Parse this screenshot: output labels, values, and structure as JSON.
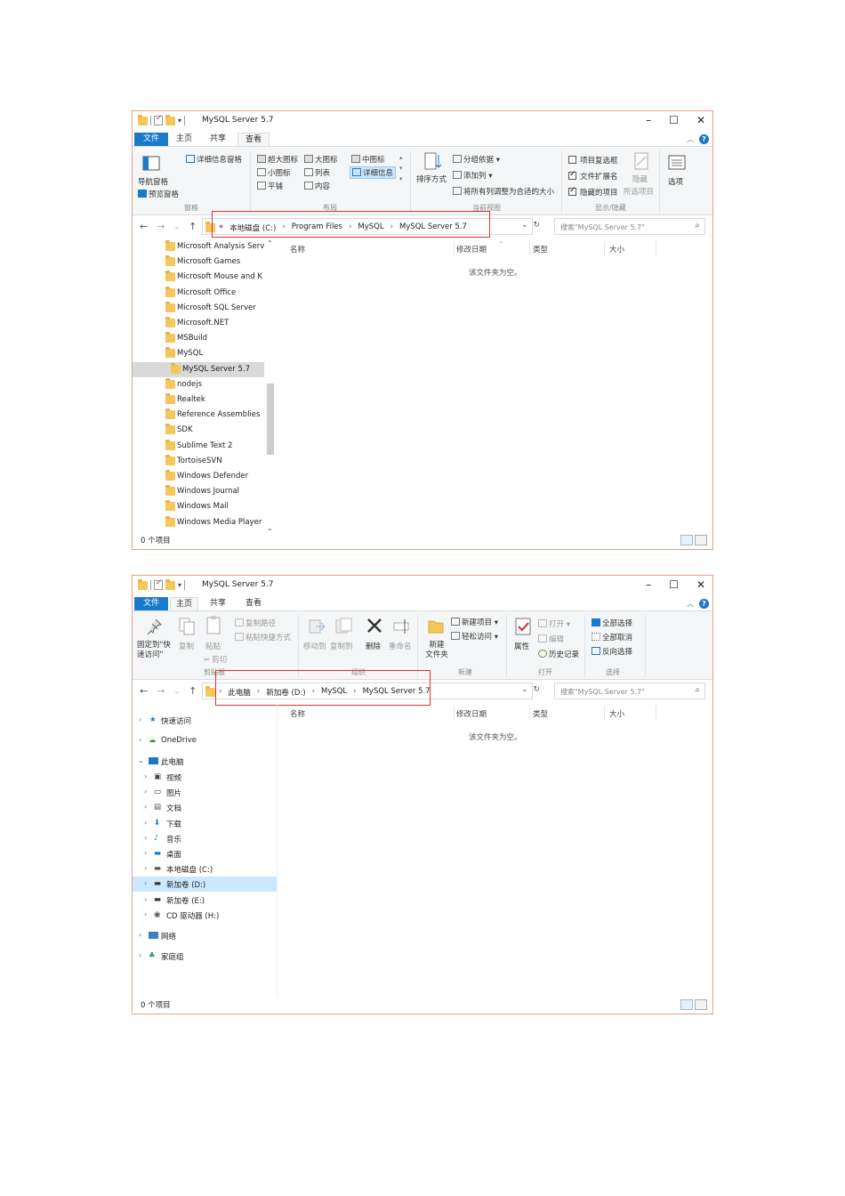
{
  "window1": {
    "title": "MySQL Server 5.7",
    "tabs": [
      "文件",
      "主页",
      "共享",
      "查看"
    ],
    "ribbon": {
      "panes_group": {
        "nav_pane": "导航窗格",
        "preview_pane": "预览窗格",
        "details_pane": "详细信息窗格",
        "label": "窗格"
      },
      "layout_group": {
        "items": [
          "超大图标",
          "大图标",
          "中图标",
          "小图标",
          "列表",
          "详细信息",
          "平铺",
          "内容"
        ],
        "label": "布局"
      },
      "view_group": {
        "sort": "排序方式",
        "group_by": "分组依据",
        "add_col": "添加列",
        "fit_cols": "将所有列调整为合适的大小",
        "label": "当前视图"
      },
      "show_group": {
        "item_checkboxes": "项目复选框",
        "file_ext": "文件扩展名",
        "hidden_items": "隐藏的项目",
        "hide": "隐藏",
        "hide_sel": "所选项目",
        "options": "选项",
        "label": "显示/隐藏"
      }
    },
    "path": [
      "«",
      "本地磁盘 (C:)",
      "Program Files",
      "MySQL",
      "MySQL Server 5.7"
    ],
    "search_placeholder": "搜索\"MySQL Server 5.7\"",
    "nav_items": [
      "Microsoft Analysis Servi",
      "Microsoft Games",
      "Microsoft Mouse and K",
      "Microsoft Office",
      "Microsoft SQL Server",
      "Microsoft.NET",
      "MSBuild",
      "MySQL",
      "MySQL Server 5.7",
      "nodejs",
      "Realtek",
      "Reference Assemblies",
      "SDK",
      "Sublime Text 2",
      "TortoiseSVN",
      "Windows Defender",
      "Windows Journal",
      "Windows Mail",
      "Windows Media Player"
    ],
    "columns": [
      "名称",
      "修改日期",
      "类型",
      "大小"
    ],
    "empty_text": "该文件夹为空。",
    "status": "0 个项目"
  },
  "window2": {
    "title": "MySQL Server 5.7",
    "tabs": [
      "文件",
      "主页",
      "共享",
      "查看"
    ],
    "ribbon": {
      "clipboard": {
        "pin": "固定到\"快速访问\"",
        "copy": "复制",
        "paste": "粘贴",
        "copy_path": "复制路径",
        "paste_shortcut": "粘贴快捷方式",
        "cut": "剪切",
        "label": "剪贴板"
      },
      "organize": {
        "move_to": "移动到",
        "copy_to": "复制到",
        "delete": "删除",
        "rename": "重命名",
        "label": "组织"
      },
      "new": {
        "new_item": "新建项目",
        "easy_access": "轻松访问",
        "new_folder": "新建\n文件夹",
        "label": "新建"
      },
      "open": {
        "properties": "属性",
        "open": "打开",
        "edit": "编辑",
        "history": "历史记录",
        "label": "打开"
      },
      "select": {
        "select_all": "全部选择",
        "select_none": "全部取消",
        "invert": "反向选择",
        "label": "选择"
      }
    },
    "path": [
      "此电脑",
      "新加卷 (D:)",
      "MySQL",
      "MySQL Server 5.7"
    ],
    "search_placeholder": "搜索\"MySQL Server 5.7\"",
    "tree": {
      "quick_access": "快速访问",
      "onedrive": "OneDrive",
      "this_pc": "此电脑",
      "pc_items": [
        "视频",
        "图片",
        "文档",
        "下载",
        "音乐",
        "桌面",
        "本地磁盘 (C:)",
        "新加卷 (D:)",
        "新加卷 (E:)",
        "CD 驱动器 (H:)"
      ],
      "network": "网络",
      "homegroup": "家庭组"
    },
    "columns": [
      "名称",
      "修改日期",
      "类型",
      "大小"
    ],
    "empty_text": "该文件夹为空。",
    "status": "0 个项目"
  },
  "colors": {
    "accent": "#1979ca",
    "folder": "#f5c75a",
    "highlight_box": "#dd3333",
    "selected": "#cce8ff"
  }
}
